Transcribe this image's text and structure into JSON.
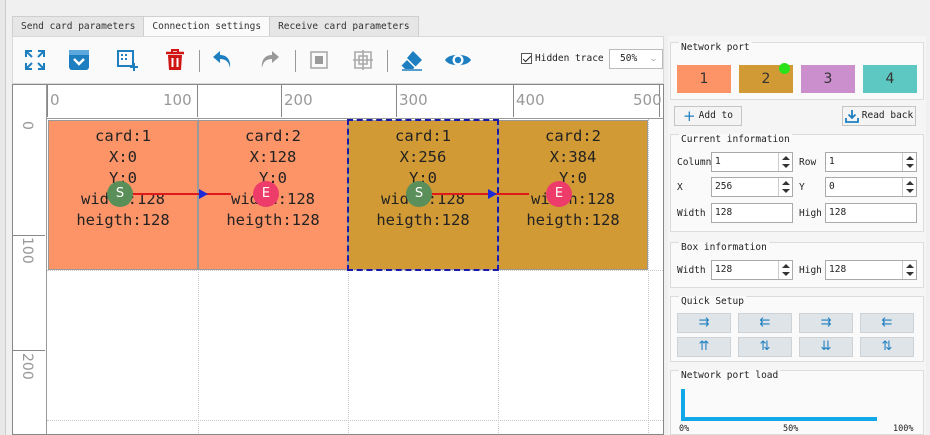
{
  "tabs": [
    {
      "label": "Send card parameters"
    },
    {
      "label": "Connection settings"
    },
    {
      "label": "Receive card parameters"
    }
  ],
  "toolbar": {
    "hidden_trace_label": "Hidden trace",
    "hidden_trace_checked": true,
    "zoom": "50%"
  },
  "ruler": {
    "h_labels": [
      "0",
      "100",
      "200",
      "300",
      "400",
      "500"
    ],
    "v_labels": [
      "0",
      "100",
      "200"
    ]
  },
  "cards": [
    {
      "lines": [
        "card:1",
        "X:0",
        "Y:0",
        "width:128",
        "heigth:128"
      ],
      "marker": "S",
      "color": "#fd9468"
    },
    {
      "lines": [
        "card:2",
        "X:128",
        "Y:0",
        "width:128",
        "heigth:128"
      ],
      "marker": "E",
      "color": "#fd9468"
    },
    {
      "lines": [
        "card:1",
        "X:256",
        "Y:0",
        "width:128",
        "heigth:128"
      ],
      "marker": "S",
      "color": "#d29a35"
    },
    {
      "lines": [
        "card:2",
        "X:384",
        "Y:0",
        "width:128",
        "heigth:128"
      ],
      "marker": "E",
      "color": "#d29a35"
    }
  ],
  "panel": {
    "network_port_title": "Network port",
    "ports": [
      {
        "label": "1",
        "color": "#fd9468"
      },
      {
        "label": "2",
        "color": "#d29a35"
      },
      {
        "label": "3",
        "color": "#cc8fce"
      },
      {
        "label": "4",
        "color": "#5dc8c2"
      }
    ],
    "add_to": "Add to",
    "read_back": "Read back",
    "current_info_title": "Current information",
    "column_label": "Column",
    "column_value": "1",
    "row_label": "Row",
    "row_value": "1",
    "x_label": "X",
    "x_value": "256",
    "y_label": "Y",
    "y_value": "0",
    "width_label": "Width",
    "width_value": "128",
    "high_label": "High",
    "high_value": "128",
    "box_info_title": "Box information",
    "box_width_label": "Width",
    "box_width_value": "128",
    "box_high_label": "High",
    "box_high_value": "128",
    "quick_setup_title": "Quick Setup",
    "quick_buttons": [
      "⇉",
      "⇇",
      "⇉",
      "⇇",
      "⇈",
      "⇅",
      "⇊",
      "⇅"
    ],
    "load_title": "Network port load",
    "load_ticks": [
      "0%",
      "50%",
      "100%"
    ]
  }
}
